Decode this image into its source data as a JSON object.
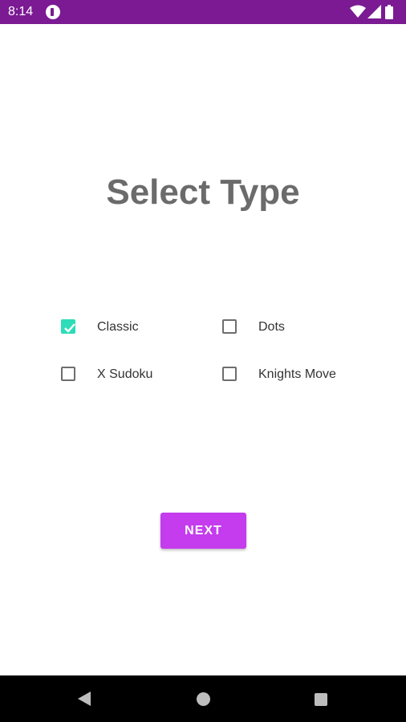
{
  "status_bar": {
    "time": "8:14",
    "background_color": "#7b1a93",
    "icons": [
      "app-notification-icon",
      "wifi-icon",
      "signal-icon",
      "battery-icon"
    ]
  },
  "screen": {
    "title": "Select Type"
  },
  "options": [
    {
      "label": "Classic",
      "checked": true
    },
    {
      "label": "Dots",
      "checked": false
    },
    {
      "label": "X Sudoku",
      "checked": false
    },
    {
      "label": "Knights Move",
      "checked": false
    }
  ],
  "next_button": {
    "label": "NEXT",
    "color": "#c43ced"
  },
  "nav_bar": {
    "buttons": [
      "back-icon",
      "home-icon",
      "recents-icon"
    ]
  },
  "colors": {
    "checkbox_checked": "#2ddcb8",
    "title_text": "#6b6b6b"
  }
}
